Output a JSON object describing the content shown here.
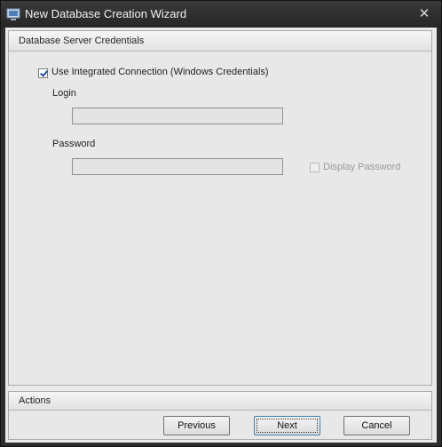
{
  "window": {
    "title": "New Database Creation Wizard",
    "close_symbol": "✕"
  },
  "credentials": {
    "header": "Database Server Credentials",
    "integrated": {
      "label": "Use Integrated Connection (Windows Credentials)",
      "checked": true
    },
    "login": {
      "label": "Login",
      "value": "",
      "placeholder": ""
    },
    "password": {
      "label": "Password",
      "value": "",
      "placeholder": ""
    },
    "display_password": {
      "label": "Display Password",
      "checked": false,
      "disabled": true
    }
  },
  "actions": {
    "header": "Actions",
    "previous": "Previous",
    "next": "Next",
    "cancel": "Cancel"
  },
  "colors": {
    "titlebar": "#2d2d2d",
    "panel": "#e8e8e8",
    "accent": "#1f4e9a"
  }
}
